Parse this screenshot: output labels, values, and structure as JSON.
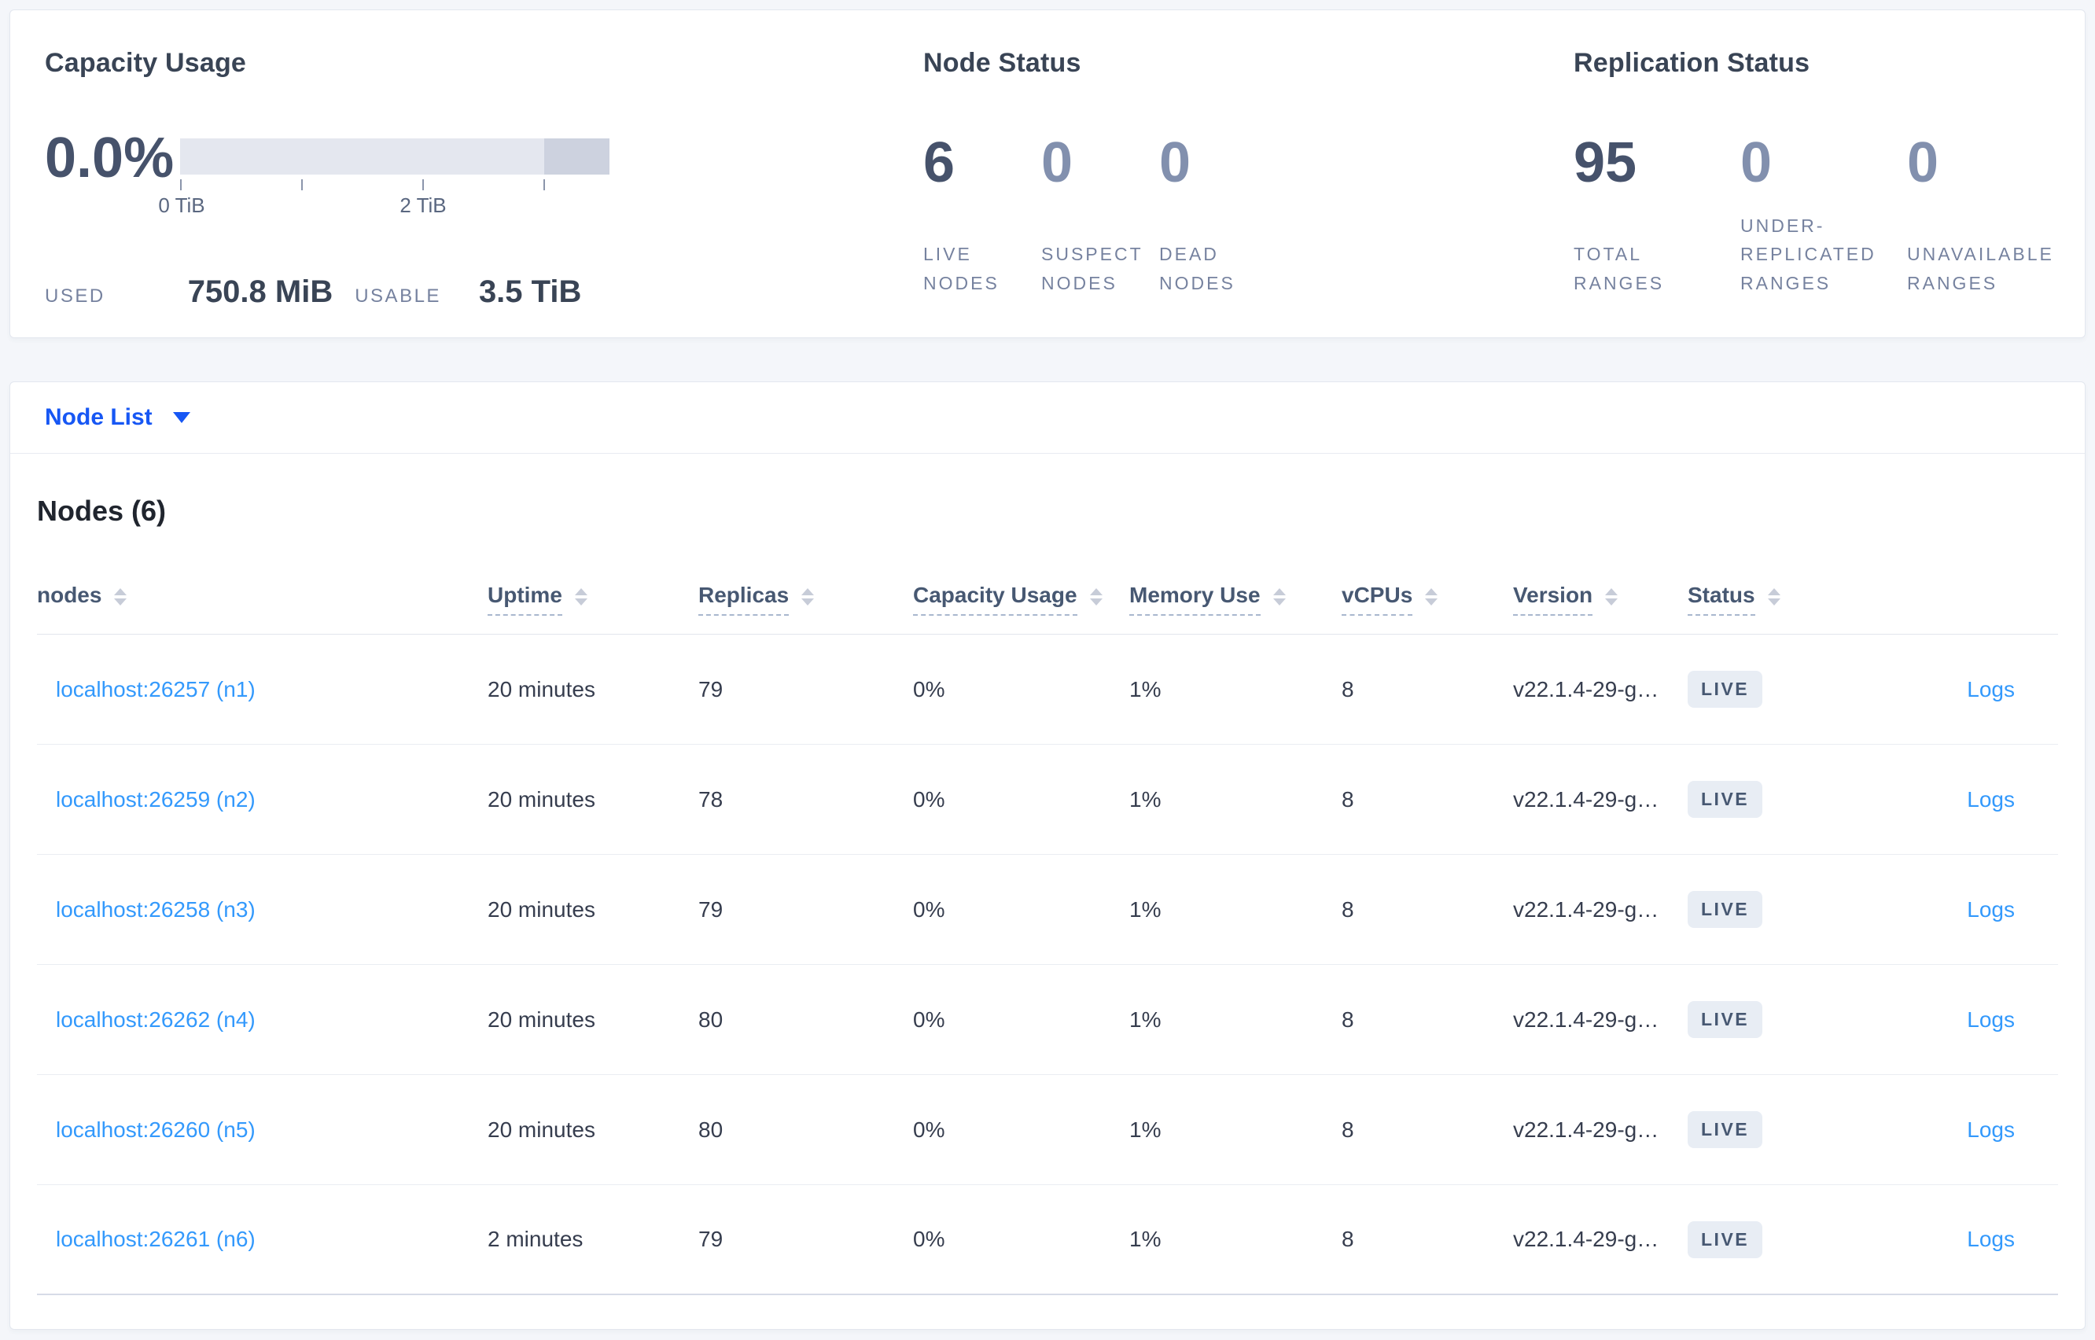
{
  "colors": {
    "page_bg": "#F4F6FA",
    "card_border": "#E3E7EF",
    "heading": "#394455",
    "muted_number": "#8290AE",
    "primary_link": "#1757F4",
    "table_link": "#3399FC",
    "badge_bg": "#E8EDF4",
    "badge_text": "#475872",
    "bar_light": "#E4E7EF",
    "bar_dark": "#CDD2DF"
  },
  "summary": {
    "capacity": {
      "title": "Capacity Usage",
      "percent": "0.0%",
      "tick_labels": [
        "0 TiB",
        "2 TiB"
      ],
      "used_label": "USED",
      "used_value": "750.8 MiB",
      "usable_label": "USABLE",
      "usable_value": "3.5 TiB"
    },
    "node_status": {
      "title": "Node Status",
      "stats": [
        {
          "value": "6",
          "label": "LIVE NODES",
          "muted": false
        },
        {
          "value": "0",
          "label": "SUSPECT NODES",
          "muted": true
        },
        {
          "value": "0",
          "label": "DEAD NODES",
          "muted": true
        }
      ]
    },
    "replication": {
      "title": "Replication Status",
      "stats": [
        {
          "value": "95",
          "label": "TOTAL RANGES",
          "muted": false
        },
        {
          "value": "0",
          "label": "UNDER-REPLICATED RANGES",
          "muted": true
        },
        {
          "value": "0",
          "label": "UNAVAILABLE RANGES",
          "muted": true
        }
      ]
    }
  },
  "view_selector": {
    "label": "Node List"
  },
  "table": {
    "title": "Nodes (6)",
    "columns": [
      {
        "label": "nodes",
        "underline": false
      },
      {
        "label": "Uptime",
        "underline": true
      },
      {
        "label": "Replicas",
        "underline": true
      },
      {
        "label": "Capacity Usage",
        "underline": true
      },
      {
        "label": "Memory Use",
        "underline": true
      },
      {
        "label": "vCPUs",
        "underline": true
      },
      {
        "label": "Version",
        "underline": true
      },
      {
        "label": "Status",
        "underline": true
      }
    ],
    "rows": [
      {
        "node": "localhost:26257 (n1)",
        "uptime": "20 minutes",
        "replicas": "79",
        "capacity": "0%",
        "memory": "1%",
        "vcpus": "8",
        "version": "v22.1.4-29-g…",
        "status": "LIVE",
        "logs": "Logs"
      },
      {
        "node": "localhost:26259 (n2)",
        "uptime": "20 minutes",
        "replicas": "78",
        "capacity": "0%",
        "memory": "1%",
        "vcpus": "8",
        "version": "v22.1.4-29-g…",
        "status": "LIVE",
        "logs": "Logs"
      },
      {
        "node": "localhost:26258 (n3)",
        "uptime": "20 minutes",
        "replicas": "79",
        "capacity": "0%",
        "memory": "1%",
        "vcpus": "8",
        "version": "v22.1.4-29-g…",
        "status": "LIVE",
        "logs": "Logs"
      },
      {
        "node": "localhost:26262 (n4)",
        "uptime": "20 minutes",
        "replicas": "80",
        "capacity": "0%",
        "memory": "1%",
        "vcpus": "8",
        "version": "v22.1.4-29-g…",
        "status": "LIVE",
        "logs": "Logs"
      },
      {
        "node": "localhost:26260 (n5)",
        "uptime": "20 minutes",
        "replicas": "80",
        "capacity": "0%",
        "memory": "1%",
        "vcpus": "8",
        "version": "v22.1.4-29-g…",
        "status": "LIVE",
        "logs": "Logs"
      },
      {
        "node": "localhost:26261 (n6)",
        "uptime": "2 minutes",
        "replicas": "79",
        "capacity": "0%",
        "memory": "1%",
        "vcpus": "8",
        "version": "v22.1.4-29-g…",
        "status": "LIVE",
        "logs": "Logs"
      }
    ]
  }
}
